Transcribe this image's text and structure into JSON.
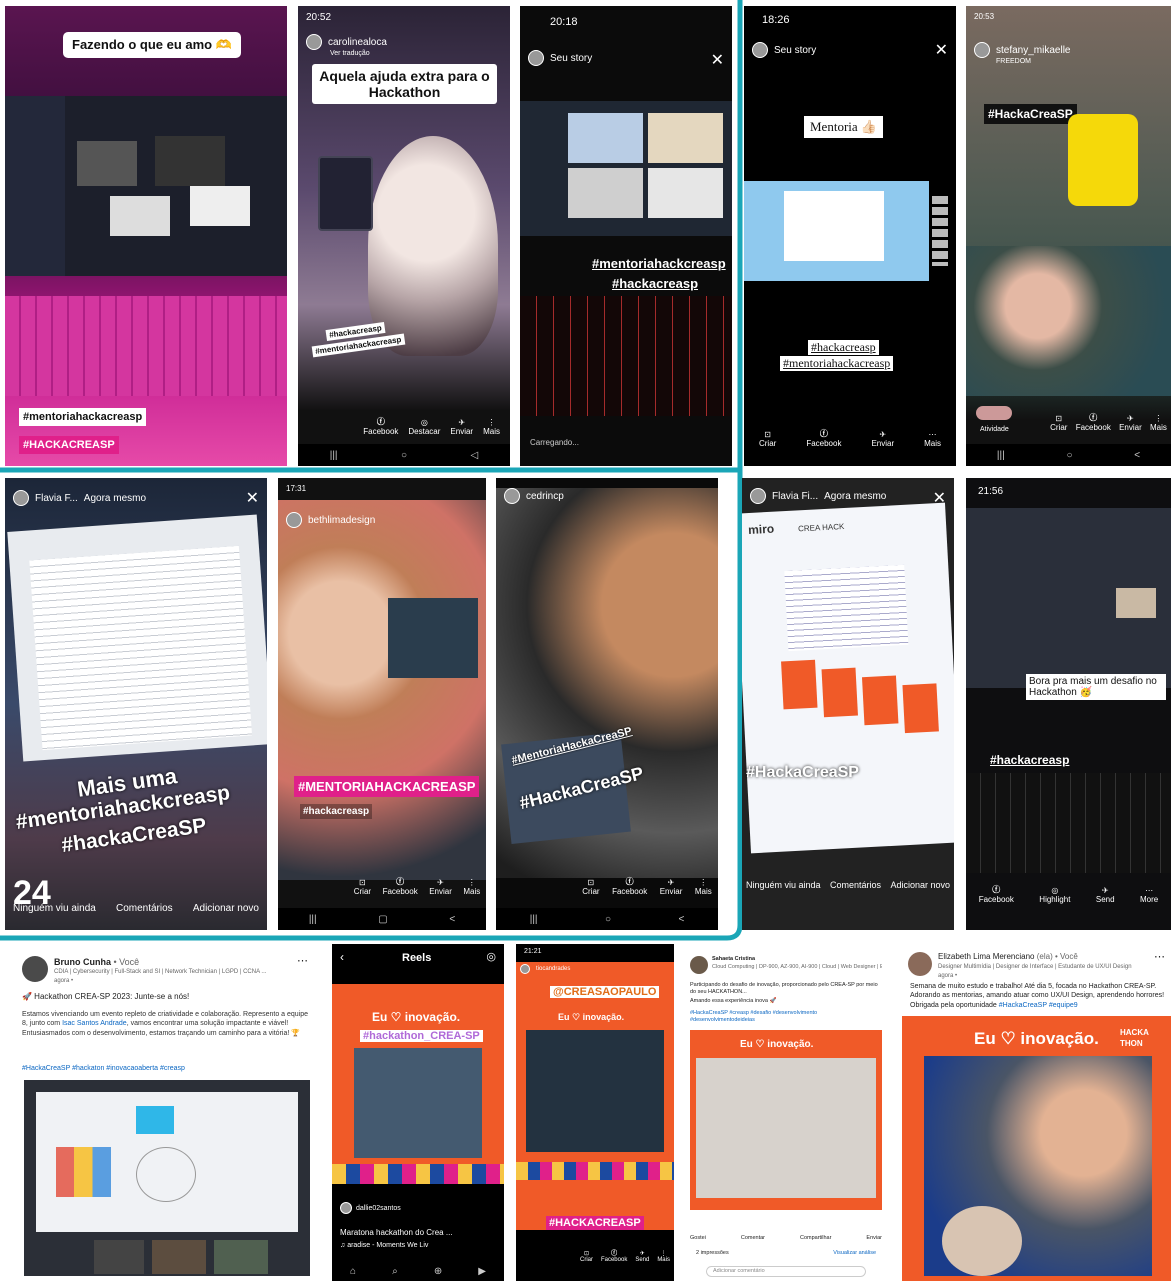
{
  "tiles": {
    "t1": {
      "top_sticker": "Fazendo o que eu amo 🫶",
      "tag1": "#mentoriahackacreasp",
      "tag2": "#HACKACREASP"
    },
    "t2": {
      "status_time": "20:52",
      "user": "carolinealoca",
      "user_sub": "Ver tradução",
      "caption": "Aquela ajuda extra para o Hackathon",
      "tag1": "#hackacreasp",
      "tag2": "#mentoriahackacreasp",
      "actions": [
        "Facebook",
        "Destacar",
        "Enviar",
        "Mais"
      ]
    },
    "t3": {
      "status_time": "20:18",
      "user": "Seu story",
      "tag1": "#mentoriahackcreasp",
      "tag2": "#hackacreasp",
      "loading": "Carregando..."
    },
    "t4": {
      "status_time": "18:26",
      "user": "Seu story",
      "sticker": "Mentoria 👍🏻",
      "tag1": "#hackacreasp",
      "tag2": "#mentoriahackacreasp",
      "actions": [
        "Criar",
        "Facebook",
        "Enviar",
        "Mais"
      ]
    },
    "t5": {
      "status_time": "20:53",
      "user": "stefany_mikaelle",
      "user_sub": "FREEDOM",
      "tag": "#HackaCreaSP",
      "activity": "Atividade",
      "actions": [
        "Criar",
        "Facebook",
        "Enviar",
        "Mais"
      ]
    },
    "t6": {
      "user": "Flavia F...",
      "time": "Agora mesmo",
      "caption1": "Mais uma",
      "caption2": "#mentoriahackcreasp",
      "caption3": "#hackaCreaSP",
      "views": "24",
      "views_label": "Ninguém viu ainda",
      "btn1": "Comentários",
      "btn2": "Adicionar novo"
    },
    "t7": {
      "status_time": "17:31",
      "user": "bethlimadesign",
      "tag1": "#MENTORIAHACKACREASP",
      "tag2": "#hackacreasp",
      "actions": [
        "Criar",
        "Facebook",
        "Enviar",
        "Mais"
      ]
    },
    "t8": {
      "user": "cedrincp",
      "tag1": "#MentoriaHackaCreaSP",
      "tag2": "#HackaCreaSP",
      "actions": [
        "Criar",
        "Facebook",
        "Enviar",
        "Mais"
      ]
    },
    "t9": {
      "user": "Flavia Fi...",
      "time": "Agora mesmo",
      "app": "miro",
      "board": "CREA HACK",
      "tag": "#HackaCreaSP",
      "views_label": "Ninguém viu ainda",
      "btn1": "Comentários",
      "btn2": "Adicionar novo"
    },
    "t10": {
      "status_time": "21:56",
      "caption": "Bora pra mais um desafio no Hackathon 🥳",
      "tag": "#hackacreasp",
      "actions": [
        "Facebook",
        "Highlight",
        "Send",
        "More"
      ]
    }
  },
  "posts": {
    "p1": {
      "name": "Bruno Cunha",
      "you": "• Você",
      "headline": "CDIA | Cybersecurity | Full-Stack and SI | Network Technician | LGPD | CCNA ...",
      "time": "agora •",
      "title": "🚀 Hackathon CREA-SP 2023: Junte-se a nós!",
      "body": "Estamos vivenciando um evento repleto de criatividade e colaboração. Represento a equipe 8, junto com",
      "mention": "Isac Santos Andrade",
      "body2": ", vamos encontrar uma solução impactante e viável! Entusiasmados com o desenvolvimento, estamos traçando um caminho para a vitória! 🏆",
      "tags": "#HackaCreaSP #hackaton #inovacaoaberta #creasp"
    },
    "p2": {
      "title": "Reels",
      "frame_text": "Eu ♡ inovação.",
      "tag": "#hackathon_CREA-SP",
      "user": "dallie02santos",
      "caption": "Maratona hackathon do Crea ...",
      "music": "♫ aradise - Moments We Liv"
    },
    "p3": {
      "status_time": "21:21",
      "user": "tiocandrades",
      "tag1": "@CREASAOPAULO",
      "frame_text": "Eu ♡ inovação.",
      "tag2": "#HACKACREASP",
      "actions": [
        "Criar",
        "Facebook",
        "Send",
        "Mais"
      ]
    },
    "p4": {
      "name": "Sahaeta Cristina",
      "headline": "Cloud Computing | DP-900, AZ-900, AI-900 | Cloud | Web Designer | Estuda...",
      "body": "Participando do desafio de inovação, proporcionado pelo CREA-SP por meio do seu HACKATHON...",
      "body2": "Amando essa experiência inova 🚀",
      "tags": "#HackaCreaSP #creasp #desafio #desenvolvimento #desenvolvimentodeideias",
      "frame_text": "Eu ♡ inovação.",
      "actions": [
        "Gostei",
        "Comentar",
        "Compartilhar",
        "Enviar"
      ],
      "impressions": "2 impressões",
      "analytics": "Visualizar análise",
      "comment": "Adicionar comentário"
    },
    "p5": {
      "name": "Elizabeth Lima Merenciano",
      "pron": "(ela) • Você",
      "headline": "Designer Multimídia | Designer de Interface | Estudante de UX/UI Design",
      "time": "agora •",
      "body": "Semana de muito estudo e trabalho! Até dia 5, focada no Hackathon CREA-SP. Adorando as mentorias, amando atuar como UX/UI Design, aprendendo horrores! Obrigada pela oportunidade",
      "tags": "#HackaCreaSP #equipe9",
      "frame_text": "Eu ♡ inovação.",
      "logo": "HACKA THON"
    }
  },
  "colors": {
    "teal": "#1aa6b7",
    "pink": "#e0208a",
    "orange": "#f05a28",
    "linkedin": "#0a66c2"
  }
}
